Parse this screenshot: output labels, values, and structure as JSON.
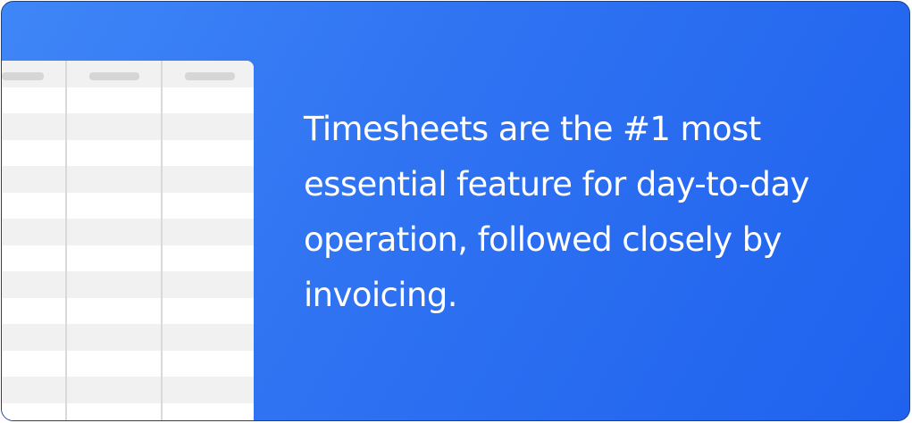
{
  "colors": {
    "card_gradient_start": "#3f86f7",
    "card_gradient_end": "#1f62ee",
    "card_border": "#1d3f8f",
    "sheet_background": "#ffffff",
    "sheet_row_shade": "#f1f1f1",
    "sheet_grid_line": "#d9d9d9",
    "text": "#ffffff"
  },
  "quote": {
    "text": "Timesheets are the #1 most essential feature for day-to-day operation, followed closely by invoicing."
  }
}
